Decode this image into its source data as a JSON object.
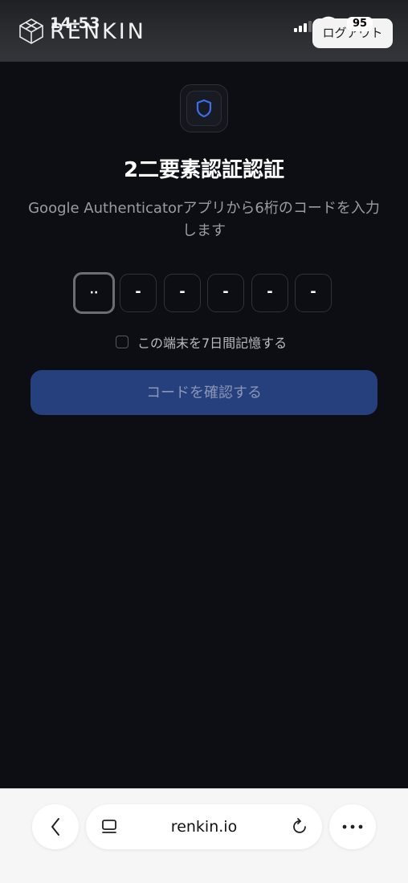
{
  "status_bar": {
    "time": "14:53",
    "battery": "95"
  },
  "header": {
    "logo_text": "RENKIN",
    "logout_label": "ログアウト"
  },
  "page": {
    "title": "2二要素認証認証",
    "description": "Google Authenticatorアプリから6桁のコードを入力します",
    "otp_digits": [
      "··",
      "-",
      "-",
      "-",
      "-",
      "-"
    ],
    "remember_label": "この端末を7日間記憶する",
    "verify_label": "コードを確認する"
  },
  "browser": {
    "url": "renkin.io"
  },
  "colors": {
    "accent": "#2a4a9a",
    "shield": "#3b6df0",
    "background": "#0d0e13"
  }
}
